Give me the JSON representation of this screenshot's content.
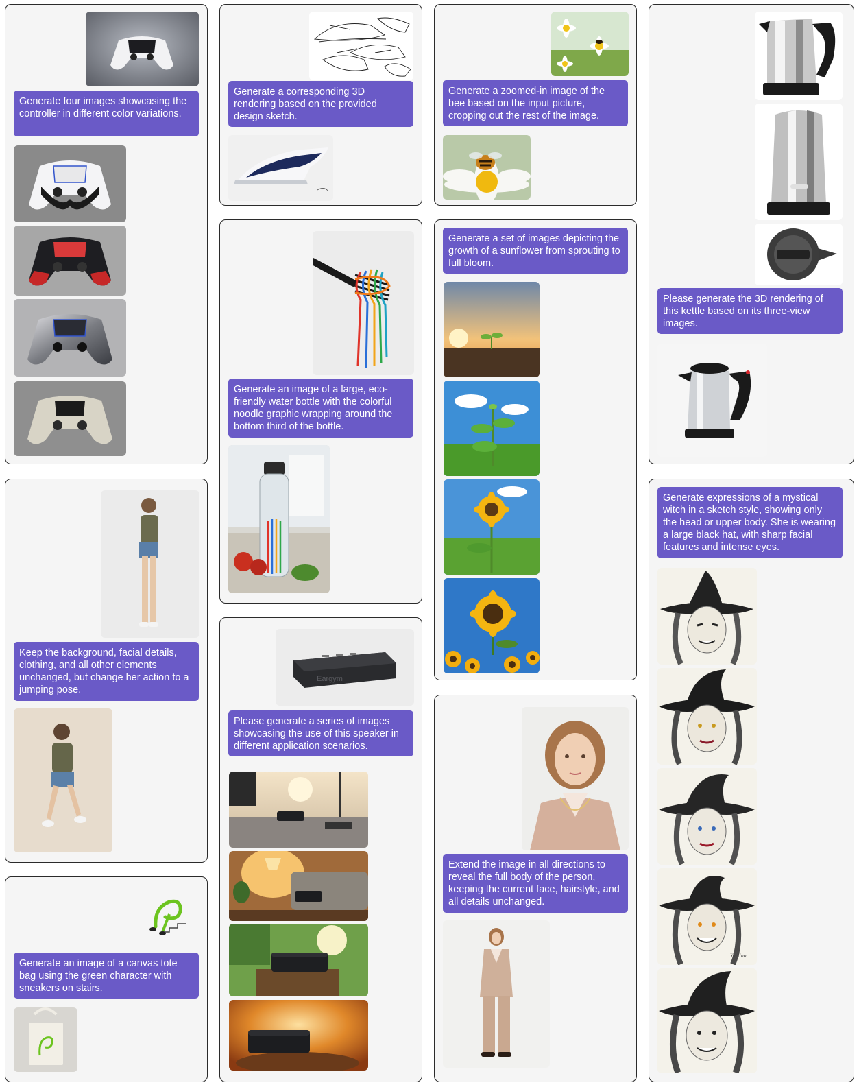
{
  "prompts": {
    "controller": "Generate four images showcasing the controller in different color variations.",
    "jump": "Keep the background, facial details, clothing, and all other elements unchanged, but change her action to a jumping pose.",
    "tote": "Generate an image of a canvas tote bag using the green character with sneakers on stairs.",
    "iron": "Generate a corresponding 3D rendering based on the provided design sketch.",
    "bottle": "Generate an image of a large, eco-friendly water bottle with the colorful noodle graphic wrapping around the bottom third of the bottle.",
    "speaker": "Please generate a series of images showcasing the use of this speaker in different application scenarios.",
    "bee": "Generate a zoomed-in image of the bee based on the input picture, cropping out the rest of the image.",
    "sunflower": "Generate a set of images depicting the growth of a sunflower from sprouting to full bloom.",
    "extend": "Extend the image in all directions to reveal the full body of the person, keeping the current face, hairstyle, and all details unchanged.",
    "kettle": "Please generate the 3D rendering of this kettle based on its three-view images.",
    "witch": "Generate expressions of a mystical witch in a sketch style, showing only the head or upper body. She is wearing a large black hat, with sharp facial features and intense eyes."
  },
  "speaker_brand": "Eargym",
  "witch_signature": "Yaelina",
  "colors": {
    "prompt_bg": "#6a5ac7",
    "card_border": "#2b2b2b",
    "card_bg": "#f5f5f5"
  }
}
